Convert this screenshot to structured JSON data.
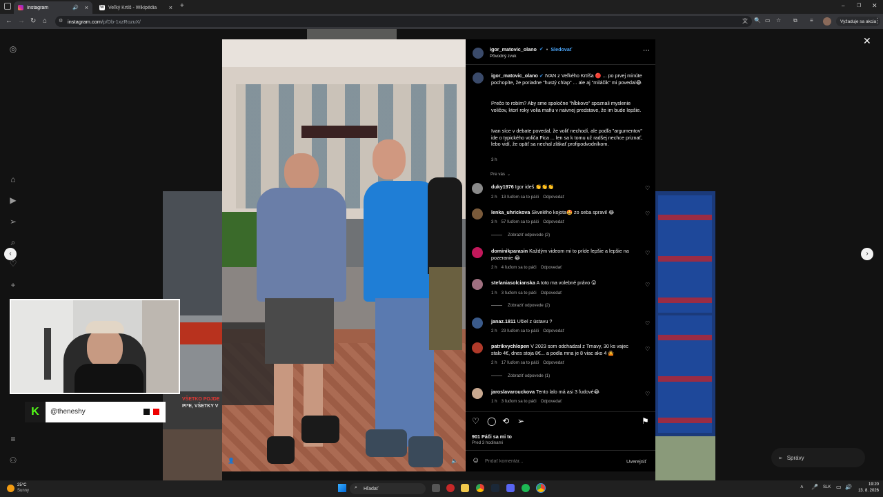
{
  "browser": {
    "tabs": [
      {
        "label": "Instagram",
        "active": true
      },
      {
        "label": "Veľký Krtíš - Wikipédia",
        "active": false
      }
    ],
    "url_host": "instagram.com",
    "url_path": "/p/Db-1xzRozuX/",
    "akcia_button": "Vyžaduje sa akcia"
  },
  "post": {
    "author": "igor_matovic_olano",
    "follow_label": "Sledovať",
    "audio_label": "Pôvodný zvuk",
    "caption_p1": "IVAN z Veľkého Krtíša 🔴 ... po prvej minúte pochopíte, že poriadne \"hustý chlap\" ... ale aj \"miláčik\" mi povedal😂",
    "caption_p2": "Prečo to robím? Aby sme spoločne \"hĺbkovo\" spoznali myslenie voličov, ktorí roky volia mafiu v naivnej predstave, že im bude lepšie.",
    "caption_p3": "Ivan síce v debate povedal, že voliť nechodí, ale podľa \"argumentov\" ide o typického voliča Fica ... len sa k tomu už radšej nechce priznať, lebo vidí, že opäť sa nechal zlákať profipodvodníkom.",
    "caption_time": "3 h",
    "sort_label": "Pre vás",
    "likes": "901 Páči sa mi to",
    "posted": "Pred 3 hodinami",
    "add_comment_placeholder": "Pridať komentár...",
    "publish_label": "Uverejniť"
  },
  "comments": [
    {
      "user": "duky1976",
      "text": "Igor ideš 👏👏👏",
      "time": "2 h",
      "likes": "13 ľuďom sa to páči",
      "reply": "Odpovedať",
      "avatar_color": "#8a8a8a"
    },
    {
      "user": "lenka_uhrickova",
      "text": "Skvelého kojota🤩 zo seba spravil 😂",
      "time": "3 h",
      "likes": "57 ľuďom sa to páči",
      "reply": "Odpovedať",
      "avatar_color": "#7a5a3a",
      "view_replies": "Zobraziť odpovede (2)"
    },
    {
      "user": "dominikparasin",
      "text": "Každým videom mi to príde lepšie a lepšie na pozeranie 😂",
      "time": "2 h",
      "likes": "4 ľuďom sa to páči",
      "reply": "Odpovedať",
      "avatar_color": "#c2185b"
    },
    {
      "user": "stefaniasolcianska",
      "text": "A toto ma volebné právo 😮",
      "time": "1 h",
      "likes": "3 ľuďom sa to páči",
      "reply": "Odpovedať",
      "avatar_color": "#a07080",
      "view_replies": "Zobraziť odpovede (2)"
    },
    {
      "user": "janaz.1811",
      "text": "Ušiel z ústavu ?",
      "time": "2 h",
      "likes": "23 ľuďom sa to páči",
      "reply": "Odpovedať",
      "avatar_color": "#3a5a8a"
    },
    {
      "user": "patrikvychlopen",
      "text": "V 2023 som odchadzal z Trnavy, 30 ks vajec stalo 4€, dnes stoja 8€... a podla mna je 8 viac ako 4 🤷",
      "time": "2 h",
      "likes": "17 ľuďom sa to páči",
      "reply": "Odpovedať",
      "avatar_color": "#b03a2a",
      "view_replies": "Zobraziť odpovede (1)"
    },
    {
      "user": "jaroslavarouckova",
      "text": "Tento lalo má asi 3 ľudové😂",
      "time": "1 h",
      "likes": "3 ľuďom sa to páči",
      "reply": "Odpovedať",
      "avatar_color": "#c8a890"
    }
  ],
  "stream": {
    "handle": "@theneshy"
  },
  "background": {
    "poster_text": "VŠETKO POJDE",
    "poster_text2": "PI*E, VŠETKY V",
    "messages_label": "Správy"
  },
  "taskbar": {
    "weather_temp": "25°C",
    "weather_desc": "Sunny",
    "search_label": "Hľadať",
    "lang": "SLK",
    "time": "19:20",
    "date": "13. 8. 2026"
  }
}
